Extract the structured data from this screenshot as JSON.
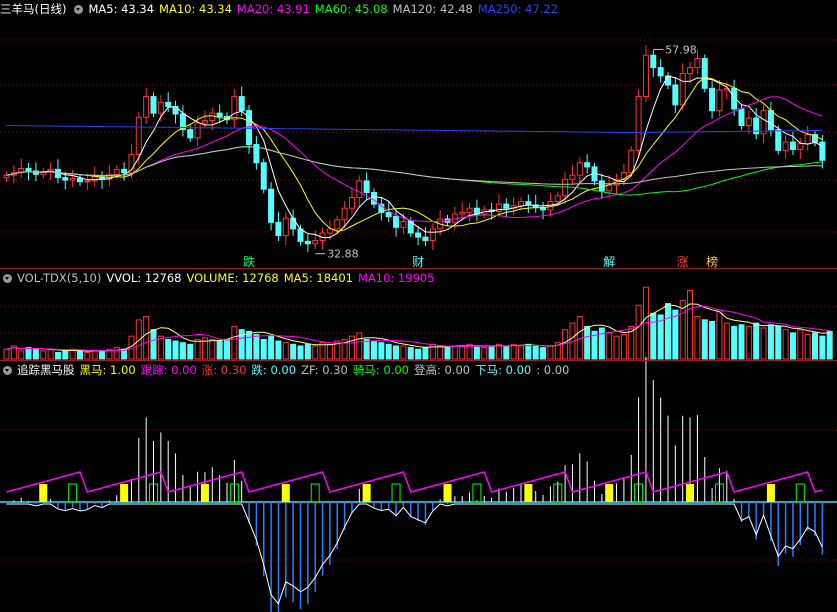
{
  "colors": {
    "background": "#000000",
    "up_candle": "#ff3232",
    "down_candle": "#54ffff",
    "ma5": "#ffffff",
    "ma10": "#ffff00",
    "ma20": "#ff00ff",
    "ma60": "#00ff00",
    "ma120": "#c0c0c0",
    "ma250": "#2244ff",
    "grid": "#7a1010",
    "signal_label": "#00ff00"
  },
  "price_panel": {
    "title": "三羊马(日线)",
    "legend": [
      {
        "name": "MA5",
        "label": "MA5: 43.34",
        "color": "#ffffff"
      },
      {
        "name": "MA10",
        "label": "MA10: 43.34",
        "color": "#ffff00"
      },
      {
        "name": "MA20",
        "label": "MA20: 43.91",
        "color": "#ff00ff"
      },
      {
        "name": "MA60",
        "label": "MA60: 45.08",
        "color": "#00ff00"
      },
      {
        "name": "MA120",
        "label": "MA120: 42.48",
        "color": "#c0c0c0"
      },
      {
        "name": "MA250",
        "label": "MA250: 47.22",
        "color": "#2244ff"
      }
    ],
    "annotations": [
      {
        "text": "57.98",
        "kind": "high",
        "index": 88
      },
      {
        "text": "32.88",
        "kind": "low",
        "index": 42
      }
    ],
    "signals": [
      {
        "text": "跌",
        "index": 33,
        "color": "#00ff66"
      },
      {
        "text": "财",
        "index": 56,
        "color": "#54ffff"
      },
      {
        "text": "解",
        "index": 82,
        "color": "#54ffff"
      },
      {
        "text": "涨",
        "index": 92,
        "color": "#ff4444"
      },
      {
        "text": "榜",
        "index": 96,
        "color": "#ffcc44"
      }
    ]
  },
  "volume_panel": {
    "legend": [
      {
        "name": "title",
        "label": "VOL-TDX(5,10)",
        "color": "#c0c0c0"
      },
      {
        "name": "vvol",
        "label": "VVOL: 12768",
        "color": "#ffffff"
      },
      {
        "name": "volume",
        "label": "VOLUME: 12768",
        "color": "#ffff00"
      },
      {
        "name": "ma5",
        "label": "MA5: 18401",
        "color": "#ffff00"
      },
      {
        "name": "ma10",
        "label": "MA10: 19905",
        "color": "#ff00ff"
      }
    ]
  },
  "indicator_panel": {
    "legend": [
      {
        "name": "title",
        "label": "追踪黑马股",
        "color": "#ffffff"
      },
      {
        "name": "heima",
        "label": "黑马: 1.00",
        "color": "#ffff00"
      },
      {
        "name": "genzong",
        "label": "跟踪: 0.00",
        "color": "#ff00ff"
      },
      {
        "name": "zhang",
        "label": "涨: 0.30",
        "color": "#ff3333"
      },
      {
        "name": "die",
        "label": "跌: 0.00",
        "color": "#54ffff"
      },
      {
        "name": "zf",
        "label": "ZF: 0.30",
        "color": "#c0c0c0"
      },
      {
        "name": "qima",
        "label": "骑马: 0.00",
        "color": "#00ff00"
      },
      {
        "name": "denggao",
        "label": "登高: 0.00",
        "color": "#c0c0c0"
      },
      {
        "name": "xiama",
        "label": "下马: 0.00",
        "color": "#54ffff"
      },
      {
        "name": "last",
        "label": ": 0.00",
        "color": "#c0c0c0"
      }
    ]
  },
  "chart_data": {
    "type": "candlestick",
    "title": "三羊马(日线)",
    "price_range": [
      31.0,
      60.5
    ],
    "closes": [
      41.5,
      41.8,
      42.3,
      42.0,
      41.6,
      41.9,
      42.2,
      41.2,
      40.9,
      41.1,
      40.7,
      40.8,
      41.3,
      41.0,
      41.6,
      42.2,
      41.8,
      44.0,
      48.5,
      51.0,
      49.0,
      50.3,
      49.8,
      48.9,
      47.0,
      46.0,
      47.8,
      48.1,
      49.0,
      48.6,
      48.2,
      51.0,
      49.3,
      45.2,
      43.0,
      39.8,
      35.8,
      34.2,
      36.3,
      35.0,
      33.5,
      33.2,
      33.6,
      34.5,
      35.0,
      36.1,
      37.5,
      38.8,
      40.8,
      39.4,
      38.0,
      37.0,
      36.5,
      35.2,
      35.9,
      34.5,
      34.0,
      33.6,
      35.0,
      36.2,
      35.8,
      36.8,
      37.0,
      37.5,
      36.8,
      37.3,
      37.1,
      38.0,
      37.5,
      37.8,
      38.3,
      37.9,
      37.6,
      37.3,
      38.3,
      39.0,
      41.0,
      41.5,
      43.0,
      42.5,
      40.8,
      39.6,
      40.3,
      41.0,
      41.8,
      44.5,
      51.0,
      56.0,
      54.5,
      53.5,
      52.4,
      50.0,
      53.8,
      54.5,
      55.6,
      52.0,
      49.3,
      51.8,
      52.0,
      49.5,
      47.5,
      48.4,
      46.5,
      49.3,
      47.0,
      44.5,
      45.5,
      44.6,
      45.3,
      46.4,
      45.5,
      43.3
    ],
    "volumes": [
      6,
      8,
      5,
      7,
      6,
      5,
      6,
      4,
      5,
      6,
      5,
      4,
      5,
      5,
      6,
      7,
      6,
      14,
      24,
      26,
      18,
      14,
      12,
      11,
      10,
      9,
      12,
      13,
      12,
      11,
      12,
      20,
      18,
      17,
      15,
      12,
      14,
      11,
      10,
      9,
      8,
      9,
      8,
      10,
      9,
      11,
      12,
      14,
      16,
      12,
      11,
      10,
      9,
      8,
      8,
      7,
      6,
      7,
      9,
      8,
      7,
      8,
      8,
      9,
      8,
      7,
      8,
      9,
      8,
      9,
      8,
      9,
      8,
      7,
      8,
      10,
      18,
      22,
      26,
      20,
      17,
      19,
      16,
      14,
      15,
      20,
      33,
      44,
      28,
      27,
      34,
      30,
      36,
      42,
      26,
      24,
      23,
      30,
      22,
      20,
      21,
      20,
      22,
      19,
      21,
      20,
      18,
      16,
      18,
      15,
      16,
      14,
      17
    ],
    "indicator": {
      "histogram_zero_based_values": true
    }
  }
}
